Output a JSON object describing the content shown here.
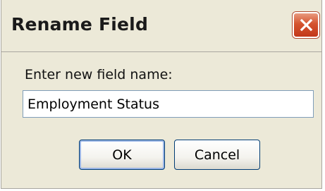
{
  "dialog": {
    "title": "Rename Field",
    "close_icon": "close-icon"
  },
  "form": {
    "prompt_label": "Enter new field name:",
    "field_value": "Employment Status"
  },
  "buttons": {
    "ok_label": "OK",
    "cancel_label": "Cancel"
  },
  "colors": {
    "dialog_background": "#ece9d8",
    "close_button": "#d5542f",
    "input_border": "#7f9db9",
    "button_border": "#003c74"
  }
}
